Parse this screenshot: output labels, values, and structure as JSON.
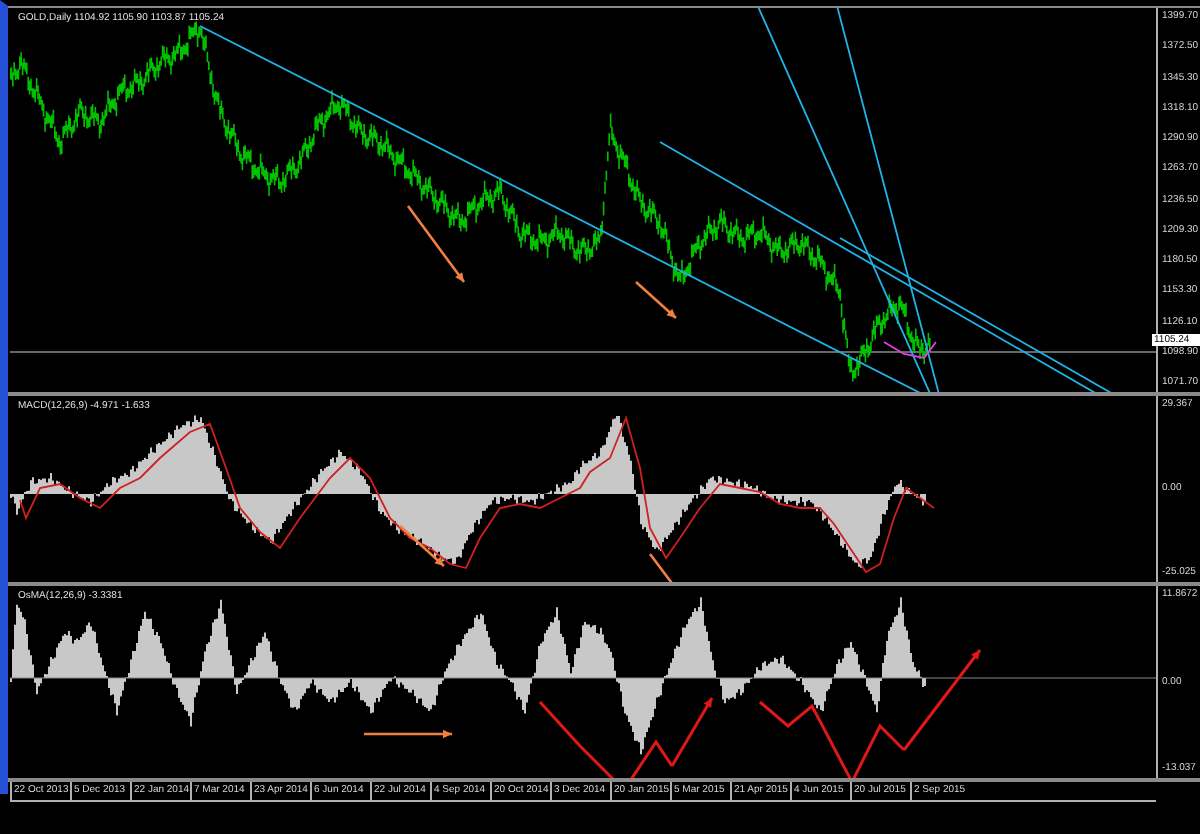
{
  "panels": [
    {
      "kind": "price",
      "label": "GOLD,Daily  1104.92 1105.90 1103.87 1105.24",
      "axis_labels": [
        "1399.70",
        "1372.50",
        "1345.30",
        "1318.10",
        "1290.90",
        "1263.70",
        "1236.50",
        "1209.30",
        "1180.50",
        "1153.30",
        "1126.10",
        "1098.90",
        "1071.70"
      ],
      "current_price": "1105.24"
    },
    {
      "kind": "macd",
      "label": "MACD(12,26,9) -4.971 -1.633",
      "axis_labels": [
        "29.367",
        "0.00",
        "-25.025"
      ]
    },
    {
      "kind": "osma",
      "label": "OsMA(12,26,9) -3.3381",
      "axis_labels": [
        "11.8672",
        "0.00",
        "-13.037"
      ]
    }
  ],
  "time_axis": [
    "22 Oct 2013",
    "5 Dec 2013",
    "22 Jan 2014",
    "7 Mar 2014",
    "23 Apr 2014",
    "6 Jun 2014",
    "22 Jul 2014",
    "4 Sep 2014",
    "20 Oct 2014",
    "3 Dec 2014",
    "20 Jan 2015",
    "5 Mar 2015",
    "21 Apr 2015",
    "4 Jun 2015",
    "20 Jul 2015",
    "2 Sep 2015"
  ]
}
